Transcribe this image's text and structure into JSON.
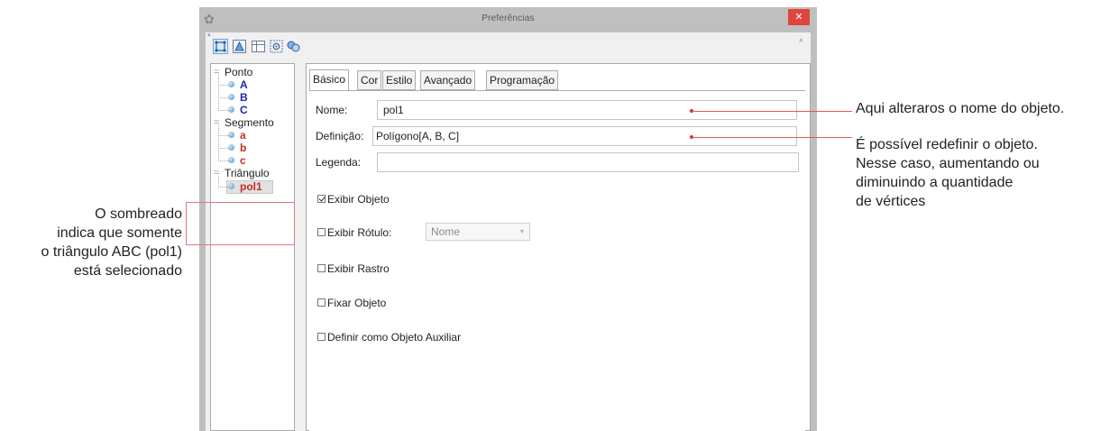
{
  "window": {
    "title": "Preferências",
    "close_label": "✕"
  },
  "tree": {
    "categories": [
      {
        "label": "Ponto",
        "toggle": "=",
        "items": [
          "A",
          "B",
          "C"
        ],
        "color": "#2424a8"
      },
      {
        "label": "Segmento",
        "toggle": "=",
        "items": [
          "a",
          "b",
          "c"
        ],
        "color": "#c0302c"
      },
      {
        "label": "Triângulo",
        "toggle": "=",
        "items": [
          "pol1"
        ],
        "color": "#c0302c",
        "selected_item": "pol1"
      }
    ]
  },
  "tabs": [
    "Básico",
    "Cor",
    "Estilo",
    "Avançado",
    "Programação"
  ],
  "active_tab": "Básico",
  "form": {
    "name_label": "Nome:",
    "name_value": "pol1",
    "definition_label": "Definição:",
    "definition_value": "Polígono[A, B, C]",
    "caption_label": "Legenda:",
    "caption_value": ""
  },
  "checkboxes": {
    "show_object": {
      "label": "Exibir Objeto",
      "checked": true
    },
    "show_label": {
      "label": "Exibir Rótulo:",
      "checked": false,
      "select_value": "Nome"
    },
    "show_trace": {
      "label": "Exibir Rastro",
      "checked": false
    },
    "fix_object": {
      "label": "Fixar Objeto",
      "checked": false
    },
    "auxiliary": {
      "label": "Definir como Objeto Auxiliar",
      "checked": false
    }
  },
  "annotations": {
    "name_note": "Aqui alteraros o nome do objeto.",
    "definition_note": [
      "É possível redefinir o objeto.",
      "Nesse caso, aumentando ou",
      "diminuindo a quantidade",
      "de vértices"
    ],
    "selection_note": [
      "O sombreado",
      "indica que somente",
      "o triângulo ABC (pol1)",
      "está selecionado"
    ]
  },
  "colors": {
    "annotation_line": "#e05a5a",
    "point_labels": "#2424a8",
    "segment_labels": "#c0302c"
  }
}
